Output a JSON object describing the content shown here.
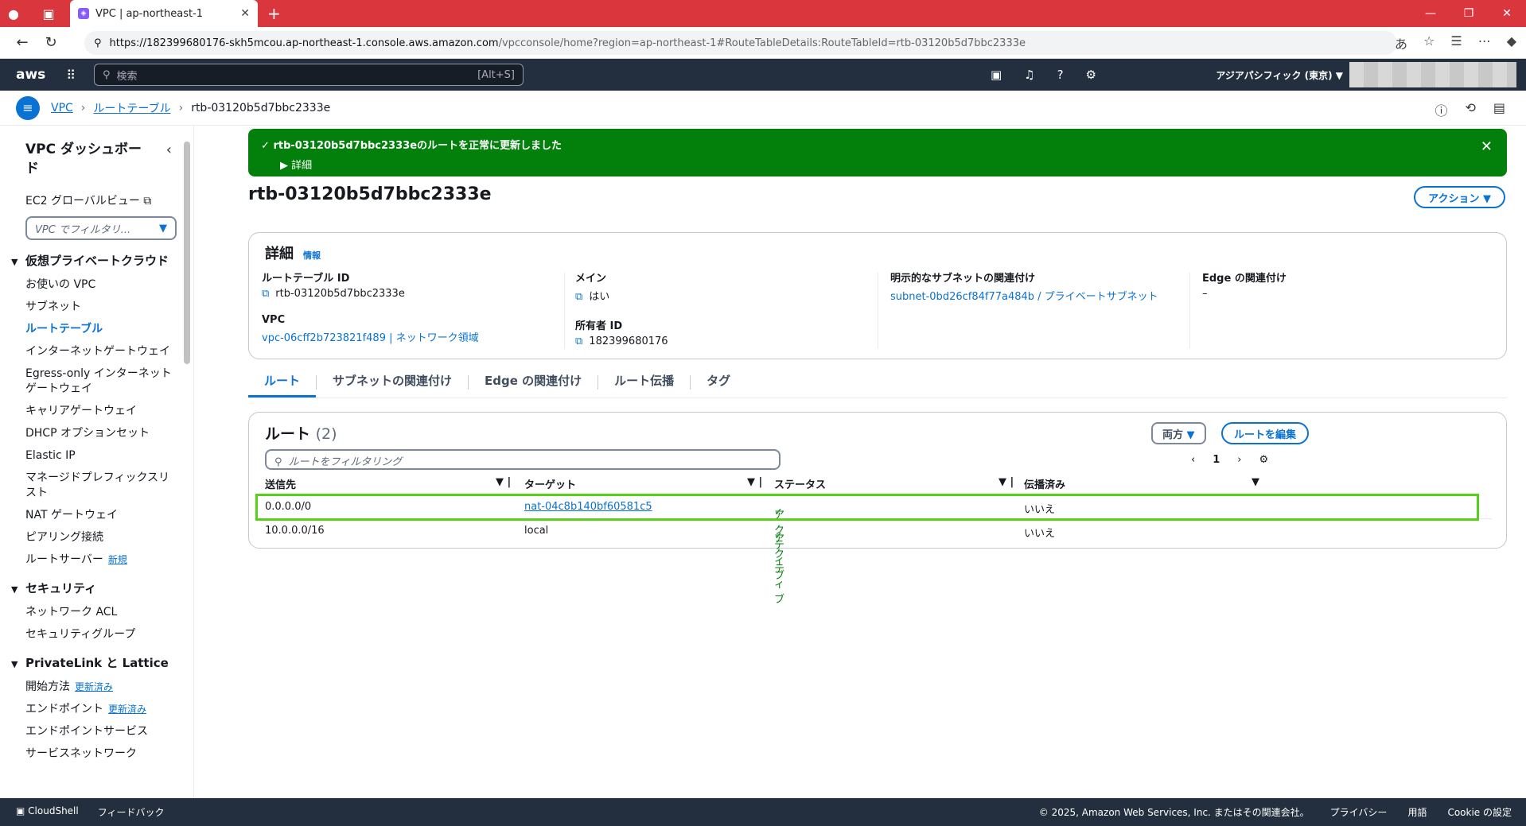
{
  "browser": {
    "tab_title": "VPC | ap-northeast-1",
    "url_host": "https://182399680176-skh5mcou.ap-northeast-1.console.aws.amazon.com",
    "url_path": "/vpcconsole/home?region=ap-northeast-1#RouteTableDetails:RouteTableId=rtb-03120b5d7bbc2333e"
  },
  "aws": {
    "logo": "aws",
    "search_placeholder": "検索",
    "search_shortcut": "[Alt+S]",
    "region": "アジアパシフィック (東京) ▼"
  },
  "breadcrumb": {
    "vpc": "VPC",
    "route_tables": "ルートテーブル",
    "current": "rtb-03120b5d7bbc2333e"
  },
  "sidebar": {
    "title": "VPC ダッシュボード",
    "ec2_link": "EC2 グローバルビュー",
    "filter_placeholder": "VPC でフィルタリ...",
    "sec1": "仮想プライベートクラウド",
    "sec1_items": [
      "お使いの VPC",
      "サブネット",
      "ルートテーブル",
      "インターネットゲートウェイ",
      "Egress-only インターネットゲートウェイ",
      "キャリアゲートウェイ",
      "DHCP オプションセット",
      "Elastic IP",
      "マネージドプレフィックスリスト",
      "NAT ゲートウェイ",
      "ピアリング接続"
    ],
    "route_server": "ルートサーバー",
    "new_badge": "新規",
    "sec2": "セキュリティ",
    "sec2_items": [
      "ネットワーク ACL",
      "セキュリティグループ"
    ],
    "sec3": "PrivateLink と Lattice",
    "getting_started": "開始方法",
    "endpoints": "エンドポイント",
    "updated_badge": "更新済み",
    "endpoint_services": "エンドポイントサービス",
    "service_network": "サービスネットワーク"
  },
  "flash": {
    "message": "rtb-03120b5d7bbc2333eのルートを正常に更新しました",
    "details": "▶ 詳細"
  },
  "page": {
    "title": "rtb-03120b5d7bbc2333e",
    "actions": "アクション ▼"
  },
  "details": {
    "heading": "詳細",
    "info": "情報",
    "rt_id_label": "ルートテーブル ID",
    "rt_id": "rtb-03120b5d7bbc2333e",
    "vpc_label": "VPC",
    "vpc": "vpc-06cff2b723821f489 | ネットワーク領域",
    "main_label": "メイン",
    "main": "はい",
    "owner_label": "所有者 ID",
    "owner": "182399680176",
    "subnet_assoc_label": "明示的なサブネットの関連付け",
    "subnet_assoc": "subnet-0bd26cf84f77a484b / プライベートサブネット",
    "edge_label": "Edge の関連付け",
    "edge": "–"
  },
  "tabs": [
    "ルート",
    "サブネットの関連付け",
    "Edge の関連付け",
    "ルート伝播",
    "タグ"
  ],
  "routes": {
    "title": "ルート",
    "count": "(2)",
    "filter_placeholder": "ルートをフィルタリング",
    "both": "両方",
    "edit": "ルートを編集",
    "page": "1",
    "headers": [
      "送信先",
      "ターゲット",
      "ステータス",
      "伝播済み"
    ],
    "rows": [
      {
        "dest": "0.0.0.0/0",
        "target": "nat-04c8b140bf60581c5",
        "status": "アクティブ",
        "prop": "いいえ"
      },
      {
        "dest": "10.0.0.0/16",
        "target": "local",
        "status": "アクティブ",
        "prop": "いいえ"
      }
    ]
  },
  "footer": {
    "cloudshell": "CloudShell",
    "feedback": "フィードバック",
    "copyright": "© 2025, Amazon Web Services, Inc. またはその関連会社。",
    "privacy": "プライバシー",
    "terms": "用語",
    "cookie": "Cookie の設定"
  }
}
